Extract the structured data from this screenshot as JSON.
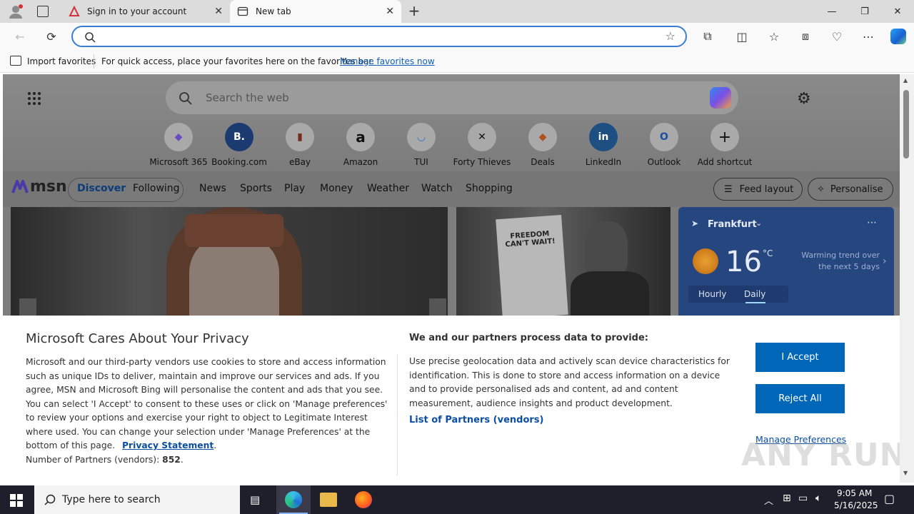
{
  "browser": {
    "tabs": [
      {
        "title": "Sign in to your account"
      },
      {
        "title": "New tab"
      }
    ],
    "favorites_bar": {
      "import_label": "Import favorites",
      "message": "For quick access, place your favorites here on the favorites bar.",
      "manage_link": "Manage favorites now"
    }
  },
  "newtab": {
    "search_placeholder": "Search the web",
    "shortcuts": [
      {
        "label": "Microsoft 365",
        "glyph": "◆"
      },
      {
        "label": "Booking.com",
        "glyph": "B."
      },
      {
        "label": "eBay",
        "glyph": "▮"
      },
      {
        "label": "Amazon",
        "glyph": "a"
      },
      {
        "label": "TUI",
        "glyph": "◡"
      },
      {
        "label": "Forty Thieves",
        "glyph": "✕"
      },
      {
        "label": "Deals",
        "glyph": "◆"
      },
      {
        "label": "LinkedIn",
        "glyph": "in"
      },
      {
        "label": "Outlook",
        "glyph": "O"
      },
      {
        "label": "Add shortcut",
        "glyph": "+"
      }
    ],
    "msn_logo": "msn",
    "feed_tabs": [
      "Discover",
      "Following"
    ],
    "nav_links": [
      "News",
      "Sports",
      "Play",
      "Money",
      "Weather",
      "Watch",
      "Shopping"
    ],
    "feed_layout_label": "Feed layout",
    "personalise_label": "Personalise",
    "weather": {
      "location": "Frankfurt",
      "temp": "16",
      "unit": "°C",
      "trend": "Warming trend over the next 5 days",
      "tabs": [
        "Hourly",
        "Daily"
      ]
    },
    "headline_image_text": "FREEDOM CAN'T WAIT!"
  },
  "consent": {
    "title": "Microsoft Cares About Your Privacy",
    "body": "Microsoft and our third-party vendors use cookies to store and access information such as unique IDs to deliver, maintain and improve our services and ads. If you agree, MSN and Microsoft Bing will personalise the content and ads that you see. You can select 'I Accept' to consent to these uses or click on 'Manage preferences' to review your options and exercise your right to object to Legitimate Interest where used.  You can change your selection under 'Manage Preferences' at the bottom of this page.",
    "privacy_link": "Privacy Statement",
    "partners_label": "Number of Partners (vendors):",
    "partners_count": "852",
    "right_title": "We and our partners process data to provide:",
    "right_body": "Use precise geolocation data and actively scan device characteristics for identification. This is done to store and access information on a device and to provide personalised ads and content, ad and content measurement, audience insights and product development.",
    "partners_link": "List of Partners (vendors)",
    "accept_label": "I Accept",
    "reject_label": "Reject All",
    "manage_label": "Manage Preferences"
  },
  "taskbar": {
    "search_placeholder": "Type here to search",
    "time": "9:05 AM",
    "date": "5/16/2025"
  },
  "watermark": "ANY RUN"
}
